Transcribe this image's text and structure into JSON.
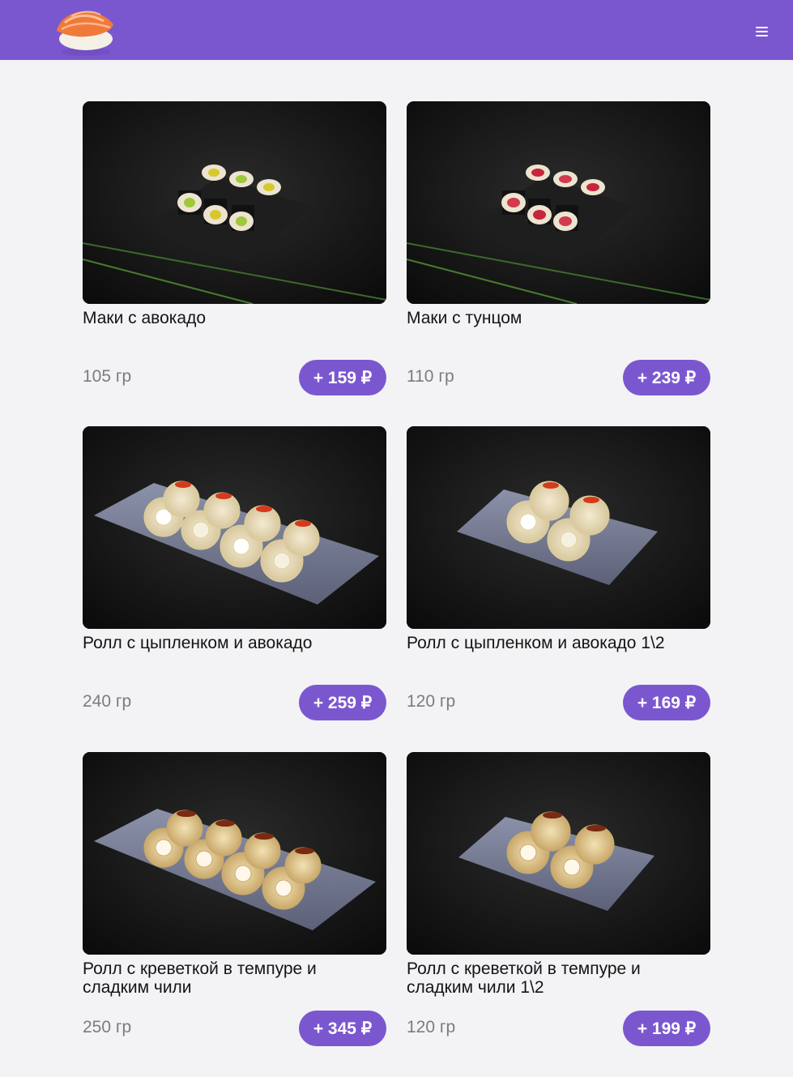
{
  "header": {
    "brand_color": "#7b57cf",
    "logo_icon": "salmon-nigiri-icon",
    "menu_icon": "hamburger-menu-icon"
  },
  "products": [
    {
      "name": "Маки с авокадо",
      "weight": "105 гр",
      "price": "+ 159 ₽",
      "photo": "maki-avocado-photo"
    },
    {
      "name": "Маки с тунцом",
      "weight": "110 гр",
      "price": "+ 239 ₽",
      "photo": "maki-tuna-photo"
    },
    {
      "name": "Ролл с цыпленком и авокадо",
      "weight": "240 гр",
      "price": "+ 259 ₽",
      "photo": "chicken-avocado-roll-photo"
    },
    {
      "name": "Ролл с цыпленком и авокадо 1\\2",
      "weight": "120 гр",
      "price": "+ 169 ₽",
      "photo": "chicken-avocado-half-roll-photo"
    },
    {
      "name": "Ролл с креветкой в темпуре и сладким чили",
      "weight": "250 гр",
      "price": "+ 345 ₽",
      "photo": "tempura-shrimp-roll-photo"
    },
    {
      "name": "Ролл с креветкой в темпуре и сладким чили 1\\2",
      "weight": "120 гр",
      "price": "+ 199 ₽",
      "photo": "tempura-shrimp-half-roll-photo"
    }
  ]
}
